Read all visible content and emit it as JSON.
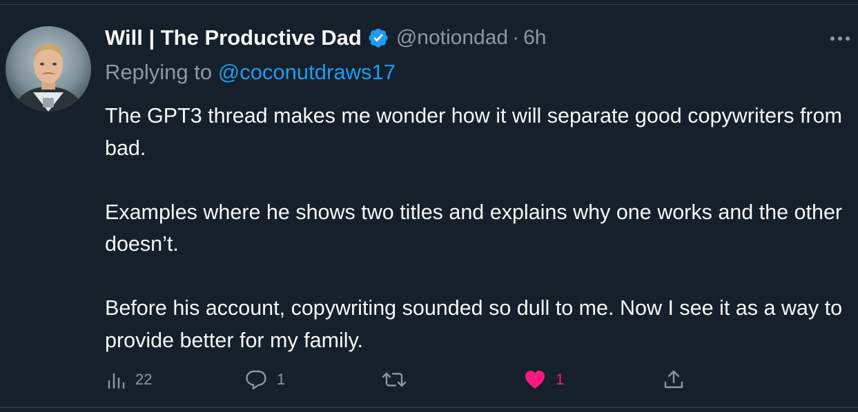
{
  "tweet": {
    "author_name": "Will | The Productive Dad",
    "handle": "@notiondad",
    "separator": "·",
    "time": "6h",
    "reply_prefix": "Replying to",
    "reply_mention": "@coconutdraws17",
    "paragraphs": [
      "The GPT3 thread makes me wonder how it will separate good copywriters from bad.",
      "Examples where he shows two titles and explains why one works and the other doesn’t.",
      "Before his account, copywriting sounded so dull to me. Now I see it as a way to provide better for my family."
    ]
  },
  "actions": {
    "views": "22",
    "replies": "1",
    "retweets": "",
    "likes": "1"
  },
  "icons": {
    "views": "bar-chart-icon",
    "reply": "speech-bubble-icon",
    "retweet": "retweet-arrows-icon",
    "like": "heart-icon",
    "share": "share-upload-icon",
    "more": "ellipsis-icon",
    "verified": "verified-badge-icon"
  },
  "colors": {
    "background": "#15202b",
    "text": "#f7f9f9",
    "muted": "#8b98a5",
    "link": "#1d9bf0",
    "like": "#f91880"
  }
}
